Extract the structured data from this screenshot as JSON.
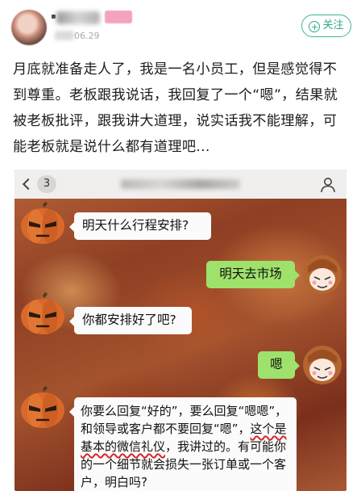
{
  "post": {
    "date_fragment": "06.29",
    "follow_label": "关注",
    "follow_icon": "+",
    "text": "月底就准备走人了，我是一名小员工，但是感觉得不到尊重。老板跟我说话，我回复了一个“嗯”，结果就被老板批评，跟我讲大道理，说实话我不能理解，可能老板就是说什么都有道理吧..."
  },
  "chat": {
    "unread_count": "3",
    "messages": [
      {
        "side": "left",
        "sender": "boss",
        "text": "明天什么行程安排?"
      },
      {
        "side": "right",
        "sender": "me",
        "text": "明天去市场"
      },
      {
        "side": "left",
        "sender": "boss",
        "text": "你都安排好了吧?"
      },
      {
        "side": "right",
        "sender": "me",
        "text": "嗯"
      },
      {
        "side": "left",
        "sender": "boss",
        "text_pre": "你要么回复“好的”，要么回复“嗯嗯”，和领导或客户都不要回复“嗯”，",
        "text_underlined": "这个是基本的微信礼仪",
        "text_post": "，我讲过的。有可能你的一个细节就会损失一张订单或一个客户，明白吗?"
      }
    ],
    "underline_color": "#d8262a",
    "bubble_green": "#9ee26b"
  },
  "colors": {
    "follow_accent": "#2fa88e"
  }
}
